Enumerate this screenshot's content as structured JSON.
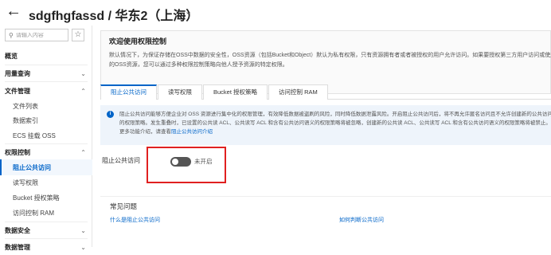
{
  "header": {
    "title": "sdgfhgfassd / 华东2（上海）",
    "back_icon": "back-arrow-icon",
    "chevron_icon": "chevron-down-icon"
  },
  "sidebar": {
    "search_placeholder": "请输入内容",
    "items": [
      {
        "label": "概览",
        "level": "top"
      },
      {
        "label": "用量查询",
        "level": "top"
      },
      {
        "label": "文件管理",
        "level": "top"
      },
      {
        "label": "文件列表",
        "level": "sub"
      },
      {
        "label": "数据索引",
        "level": "sub"
      },
      {
        "label": "ECS 挂载 OSS",
        "level": "sub"
      },
      {
        "label": "权限控制",
        "level": "top"
      },
      {
        "label": "阻止公共访问",
        "level": "sub",
        "active": true
      },
      {
        "label": "读写权限",
        "level": "sub"
      },
      {
        "label": "Bucket 授权策略",
        "level": "sub"
      },
      {
        "label": "访问控制 RAM",
        "level": "sub"
      },
      {
        "label": "数据安全",
        "level": "top"
      },
      {
        "label": "数据管理",
        "level": "top"
      }
    ]
  },
  "welcome": {
    "title": "欢迎使用权限控制",
    "text": "默认情况下，为保证存储在OSS中数据的安全性，OSS资源（包括Bucket和Object）默认为私有权限，只有资源拥有者或者被授权的用户允许访问。如果要授权第三方用户访问或使用自己的OSS资源，您可以通过多种权限控制策略向他人授予资源的特定权限。"
  },
  "tabs": [
    {
      "label": "阻止公共访问",
      "active": true
    },
    {
      "label": "读写权限"
    },
    {
      "label": "Bucket 授权策略"
    },
    {
      "label": "访问控制 RAM"
    }
  ],
  "info": {
    "text": "阻止公共访问能够方便企业对 OSS 资源进行集中化的权限管理，有效降低数据被盗刷的风险，同时降低数据泄露风险。开启阻止公共访问后，将不再允许匿名访问且不允许创建新的公共访问语义的权限策略。发生重叠时，已设置的公共读 ACL、公共读写 ACL 和含有公共访问语义的权限策略将被忽略，创建新的公共读 ACL、公共读写 ACL 和含有公共访问语义的权限策略将被禁止。了解更多功能介绍，请查看",
    "link": "阻止公共访问介绍"
  },
  "toggle": {
    "label": "阻止公共访问",
    "state_text": "未开启"
  },
  "faq": {
    "title": "常见问题",
    "links": [
      "什么是阻止公共访问",
      "如何判断公共访问"
    ]
  },
  "colors": {
    "accent": "#0064c8",
    "highlight": "#e02020"
  }
}
